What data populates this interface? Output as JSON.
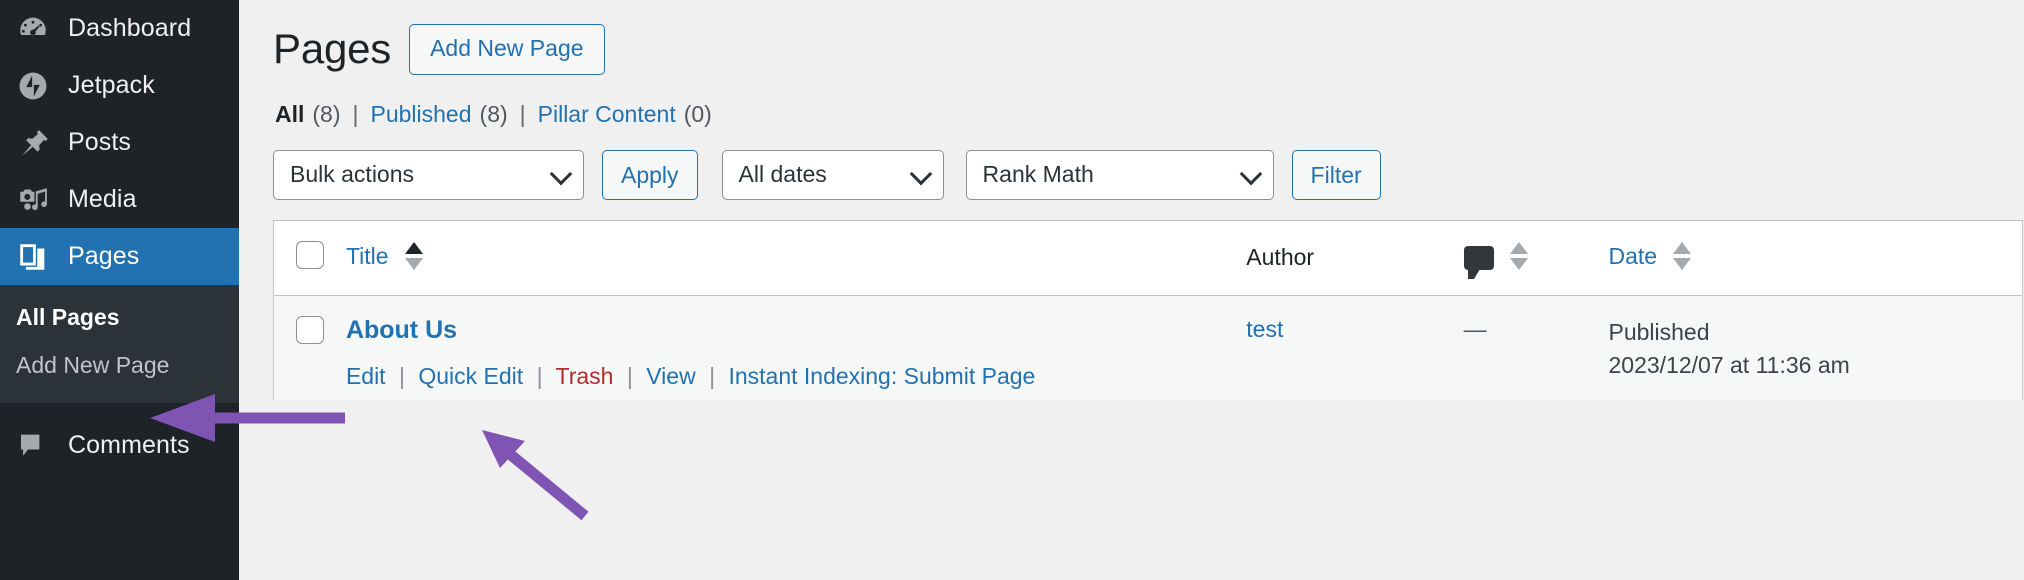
{
  "sidebar": {
    "items": [
      {
        "label": "Dashboard",
        "icon": "dashboard-icon",
        "active": false
      },
      {
        "label": "Jetpack",
        "icon": "jetpack-icon",
        "active": false
      },
      {
        "label": "Posts",
        "icon": "pin-icon",
        "active": false
      },
      {
        "label": "Media",
        "icon": "media-icon",
        "active": false
      },
      {
        "label": "Pages",
        "icon": "pages-icon",
        "active": true
      },
      {
        "label": "Comments",
        "icon": "comment-icon",
        "active": false
      }
    ],
    "submenu": [
      {
        "label": "All Pages",
        "current": true
      },
      {
        "label": "Add New Page",
        "current": false
      }
    ],
    "colors": {
      "background": "#1d2327",
      "submenu_background": "#2c3338",
      "active": "#2271b1"
    }
  },
  "header": {
    "title": "Pages",
    "add_new_label": "Add New Page"
  },
  "views": {
    "all": {
      "label": "All",
      "count": "(8)"
    },
    "published": {
      "label": "Published",
      "count": "(8)"
    },
    "pillar": {
      "label": "Pillar Content",
      "count": "(0)"
    },
    "separator": "|"
  },
  "toolbar": {
    "bulk_actions": "Bulk actions",
    "apply_label": "Apply",
    "all_dates": "All dates",
    "rank_math": "Rank Math",
    "filter_label": "Filter"
  },
  "table": {
    "headers": {
      "title": "Title",
      "author": "Author",
      "comments": "comment-icon",
      "date": "Date"
    },
    "rows": [
      {
        "title": "About Us",
        "actions": {
          "edit": "Edit",
          "quick_edit": "Quick Edit",
          "trash": "Trash",
          "view": "View",
          "instant_indexing": "Instant Indexing: Submit Page",
          "separator": "|"
        },
        "author": "test",
        "comments": "—",
        "date_status": "Published",
        "date_value": "2023/12/07 at 11:36 am"
      }
    ]
  },
  "annotations": {
    "arrow_color": "#7f54b3",
    "arrow_1_target": "All Pages",
    "arrow_2_target": "Edit"
  }
}
